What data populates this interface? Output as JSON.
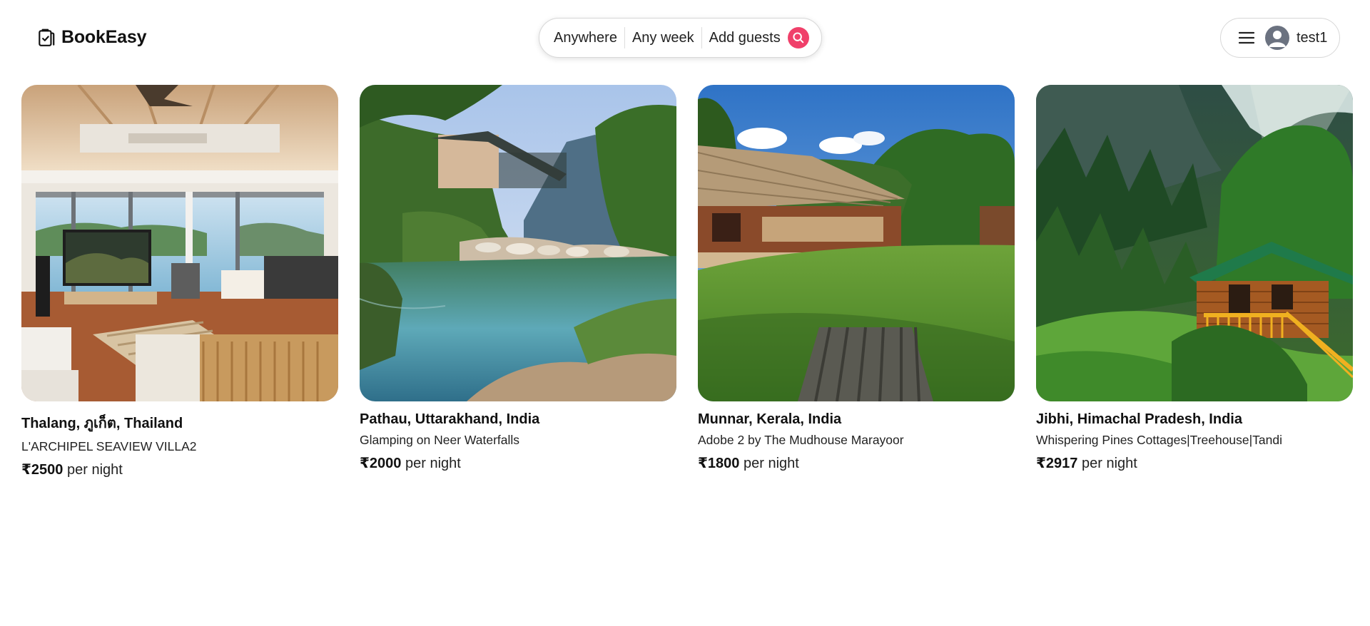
{
  "brand": {
    "name": "BookEasy",
    "icon": "clipboard-check-icon"
  },
  "search": {
    "where": "Anywhere",
    "when": "Any week",
    "who": "Add guests",
    "icon": "search-icon",
    "accent": "#f0406a"
  },
  "user": {
    "name": "test1",
    "menu_icon": "hamburger-menu-icon",
    "avatar_icon": "user-avatar-icon"
  },
  "listings": [
    {
      "location": "Thalang, ภูเก็ต, Thailand",
      "title": "L'ARCHIPEL SEAVIEW VILLA2",
      "price": "₹2500",
      "per": " per night",
      "photo": "villa-living-room-sea-view"
    },
    {
      "location": "Pathau, Uttarakhand, India",
      "title": "Glamping on Neer Waterfalls",
      "price": "₹2000",
      "per": " per night",
      "photo": "cabin-above-natural-pool-mountains"
    },
    {
      "location": "Munnar, Kerala, India",
      "title": "Adobe 2 by The Mudhouse Marayoor",
      "price": "₹1800",
      "per": " per night",
      "photo": "thatched-mud-house-lawn"
    },
    {
      "location": "Jibhi, Himachal Pradesh, India",
      "title": "Whispering Pines Cottages|Treehouse|Tandi",
      "price": "₹2917",
      "per": " per night",
      "photo": "treehouse-pine-forest"
    }
  ]
}
